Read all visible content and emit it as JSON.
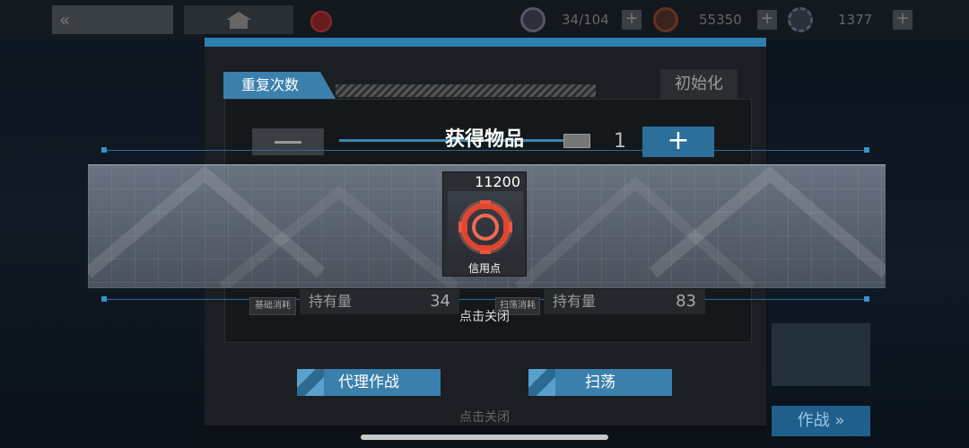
{
  "top_bar": {
    "back_label": "«",
    "resource_1": {
      "icon": "sanity-icon",
      "value": "34/104"
    },
    "resource_2": {
      "icon": "lmd-icon",
      "value": "55350"
    },
    "resource_3": {
      "icon": "orundum-icon",
      "value": "1377"
    }
  },
  "panel": {
    "repeat_label": "重复次数",
    "reset_label": "初始化",
    "count_value": "1",
    "plus_label": "+",
    "base_cost_label": "基础消耗",
    "sweep_cost_label": "扫荡消耗",
    "hold_label_left": "持有量",
    "hold_value_left": "34",
    "hold_label_right": "持有量",
    "hold_value_right": "83",
    "proxy_button": "代理作战",
    "sweep_button": "扫荡",
    "close_hint_bottom": "点击关闭"
  },
  "reward": {
    "title": "获得物品",
    "items": [
      {
        "count": "11200",
        "name": "信用点",
        "icon": "credit-icon",
        "icon_color": "#e0442e"
      }
    ],
    "close_hint": "点击关闭"
  },
  "right_side": {
    "combat_label": "作战 »"
  },
  "colors": {
    "accent_blue": "#3b80ad",
    "panel_bg": "#1b1e22",
    "band_bg": "#78828f"
  }
}
